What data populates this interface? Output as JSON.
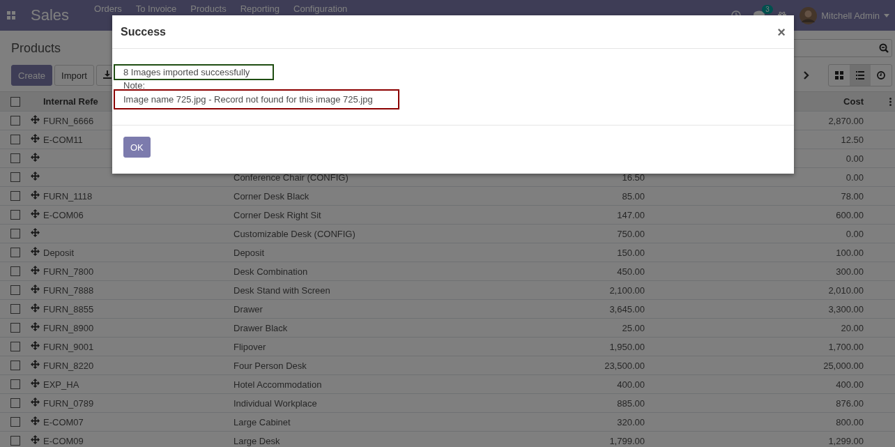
{
  "navbar": {
    "app": "Sales",
    "menu": [
      "Orders",
      "To Invoice",
      "Products",
      "Reporting",
      "Configuration"
    ],
    "message_count": "3",
    "user": "Mitchell Admin"
  },
  "control_panel": {
    "title": "Products",
    "buttons": [
      "Create",
      "Import"
    ],
    "views": [
      {
        "kind": "kanban",
        "selected": false
      },
      {
        "kind": "list",
        "selected": true
      },
      {
        "kind": "activity",
        "selected": false
      }
    ]
  },
  "table": {
    "header_checked": false,
    "columns": [
      "Internal Refe",
      "Cost"
    ],
    "rows": [
      {
        "checked": false,
        "ref": "FURN_6666",
        "cost": "2,870.00"
      },
      {
        "checked": false,
        "ref": "E-COM11",
        "cost": "12.50"
      },
      {
        "checked": false,
        "cost": "0.00"
      },
      {
        "checked": false,
        "name": "Conference Chair (CONFIG)",
        "price": "16.50",
        "cost": "0.00"
      },
      {
        "checked": false,
        "ref": "FURN_1118",
        "name": "Corner Desk Black",
        "price": "85.00",
        "cost": "78.00"
      },
      {
        "checked": false,
        "ref": "E-COM06",
        "name": "Corner Desk Right Sit",
        "price": "147.00",
        "cost": "600.00"
      },
      {
        "checked": false,
        "name": "Customizable Desk (CONFIG)",
        "price": "750.00",
        "cost": "0.00"
      },
      {
        "checked": false,
        "ref": "Deposit",
        "name": "Deposit",
        "price": "150.00",
        "cost": "100.00"
      },
      {
        "checked": false,
        "ref": "FURN_7800",
        "name": "Desk Combination",
        "price": "450.00",
        "cost": "300.00"
      },
      {
        "checked": false,
        "ref": "FURN_7888",
        "name": "Desk Stand with Screen",
        "price": "2,100.00",
        "cost": "2,010.00"
      },
      {
        "checked": false,
        "ref": "FURN_8855",
        "name": "Drawer",
        "price": "3,645.00",
        "cost": "3,300.00"
      },
      {
        "checked": false,
        "ref": "FURN_8900",
        "name": "Drawer Black",
        "price": "25.00",
        "cost": "20.00"
      },
      {
        "checked": false,
        "ref": "FURN_9001",
        "name": "Flipover",
        "price": "1,950.00",
        "cost": "1,700.00"
      },
      {
        "checked": false,
        "ref": "FURN_8220",
        "name": "Four Person Desk",
        "price": "23,500.00",
        "cost": "25,000.00"
      },
      {
        "checked": false,
        "ref": "EXP_HA",
        "name": "Hotel Accommodation",
        "price": "400.00",
        "cost": "400.00"
      },
      {
        "checked": false,
        "ref": "FURN_0789",
        "name": "Individual Workplace",
        "price": "885.00",
        "cost": "876.00"
      },
      {
        "checked": false,
        "ref": "E-COM07",
        "name": "Large Cabinet",
        "price": "320.00",
        "cost": "800.00"
      },
      {
        "checked": false,
        "ref": "E-COM09",
        "name": "Large Desk",
        "price": "1,799.00",
        "cost": "1,299.00"
      }
    ]
  },
  "dialog": {
    "title": "Success",
    "close": "×",
    "messages": [
      {
        "kind": "success",
        "text": "8 Images imported successfully"
      },
      {
        "kind": "plain",
        "text": "Note:"
      },
      {
        "kind": "error",
        "text": "Image name 725.jpg  - Record not found for this image 725.jpg"
      }
    ],
    "button": "OK"
  }
}
